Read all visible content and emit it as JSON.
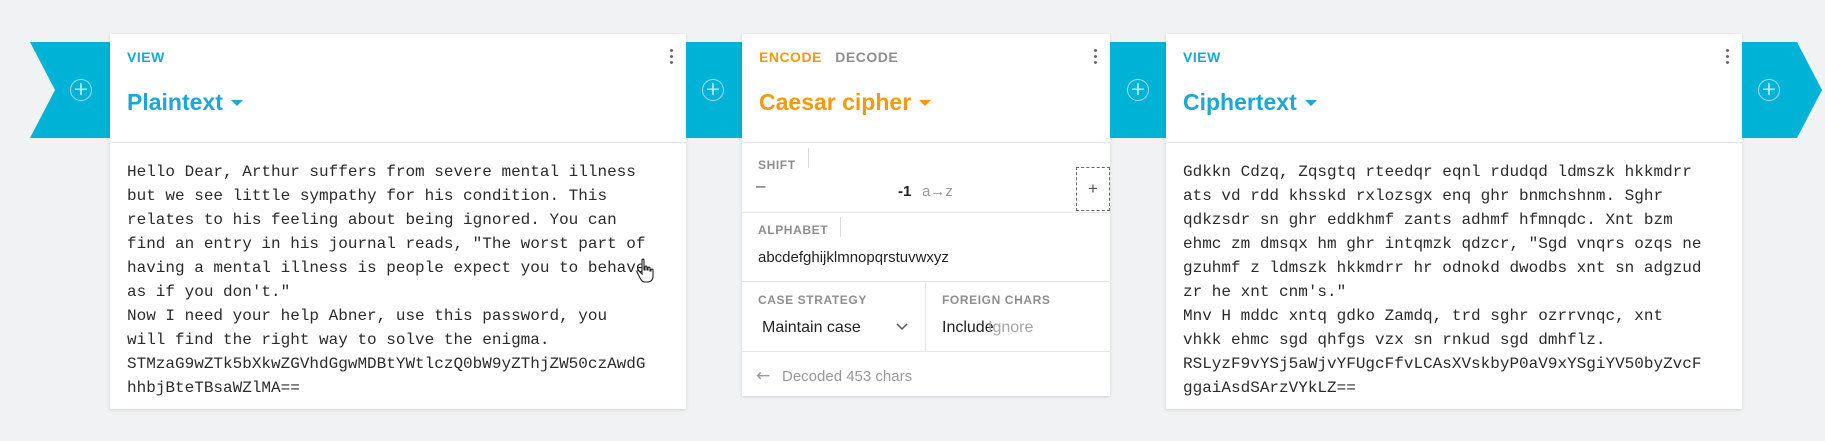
{
  "panel_left": {
    "tab": "VIEW",
    "title": "Plaintext",
    "text_lines": [
      "Hello Dear, Arthur suffers from severe mental illness",
      "but we see little sympathy for his condition. This",
      "relates to his feeling about being ignored. You can",
      "find an entry in his journal reads, \"The worst part of",
      "having a mental illness is people expect you to behave",
      "as if you don't.\"",
      "Now I need your help Abner, use this password, you",
      "will find the right way to solve the enigma.",
      "STMzaG9wZTk5bXkwZGVhdGgwMDBtYWtlczQ0bW9yZThjZW50czAwdG",
      "hhbjBteTBsaWZlMA=="
    ]
  },
  "panel_middle": {
    "tab_encode": "ENCODE",
    "tab_decode": "DECODE",
    "title": "Caesar cipher",
    "shift": {
      "label": "SHIFT",
      "minus": "–",
      "value": "-1",
      "range": "a→z",
      "plus": "+"
    },
    "alphabet": {
      "label": "ALPHABET",
      "value": "abcdefghijklmnopqrstuvwxyz"
    },
    "case_strategy": {
      "label": "CASE STRATEGY",
      "value": "Maintain case"
    },
    "foreign_chars": {
      "label": "FOREIGN CHARS",
      "include": "Include",
      "ignore": "Ignore"
    },
    "status": {
      "arrow": "←",
      "text": "Decoded 453 chars"
    }
  },
  "panel_right": {
    "tab": "VIEW",
    "title": "Ciphertext",
    "text_lines": [
      "Gdkkn Cdzq, Zqsgtq rteedqr eqnl rdudqd ldmszk hkkmdrr",
      "ats vd rdd khsskd rxlozsgx enq ghr bnmchshnm. Sghr",
      "qdkzsdr sn ghr eddkhmf zants adhmf hfmnqdc. Xnt bzm",
      "ehmc zm dmsqx hm ghr intqmzk qdzcr, \"Sgd vnqrs ozqs ne",
      "gzuhmf z ldmszk hkkmdrr hr odnokd dwodbs xnt sn adgzud",
      "zr he xnt cnm's.\"",
      "Mnv H mddc xntq gdko Zamdq, trd sghr ozrrvnqc, xnt",
      "vhkk ehmc sgd qhfgs vzx sn rnkud sgd dmhflz.",
      "RSLyzF9vYSj5aWjvYFUgcFfvLCAsXVskbyP0aV9xYSgiYV50byZvcF",
      "ggaiAsdSArzVYkLZ=="
    ]
  },
  "colors": {
    "teal": "#00b2d6",
    "blue": "#1ea7d2",
    "orange": "#f39a10"
  }
}
